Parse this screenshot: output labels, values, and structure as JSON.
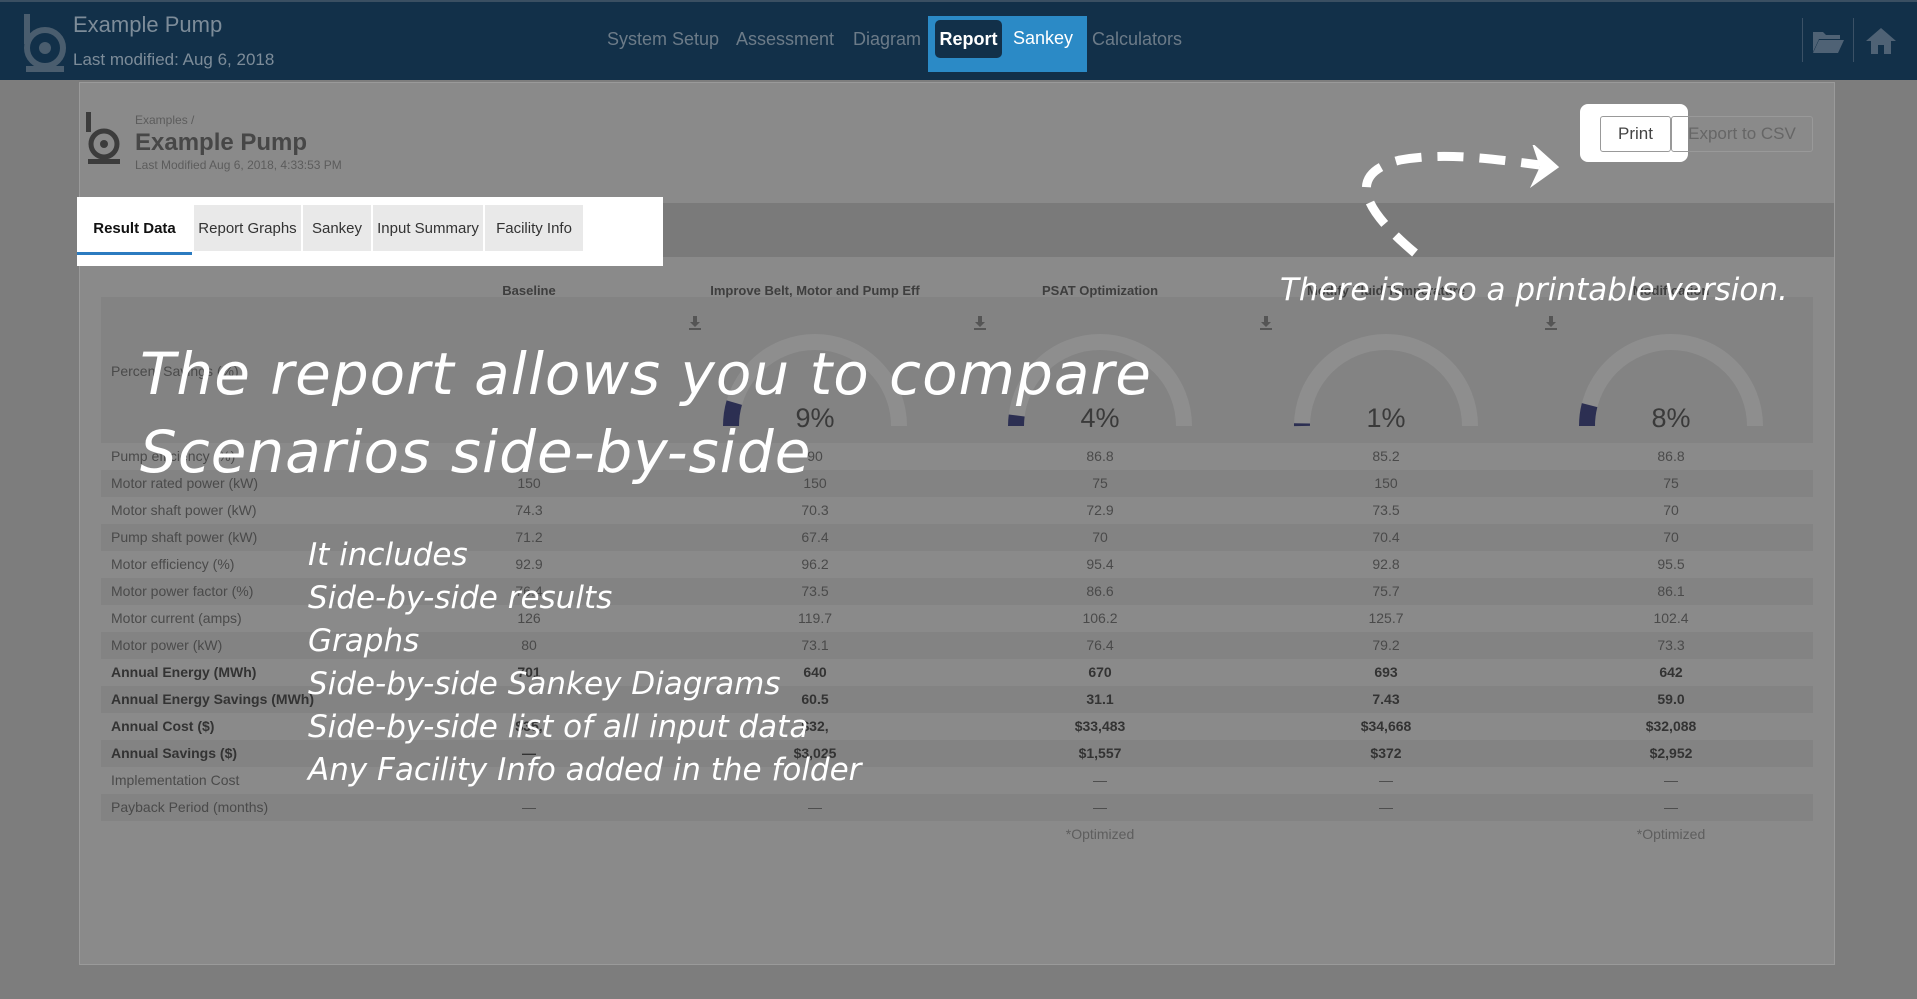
{
  "navbar": {
    "title": "Example Pump",
    "last_modified": "Last modified: Aug 6, 2018",
    "tabs": {
      "system_setup": "System Setup",
      "assessment": "Assessment",
      "diagram": "Diagram",
      "report": "Report",
      "sankey": "Sankey",
      "calculators": "Calculators"
    },
    "icons": [
      "pump-logo-icon",
      "folder-open-icon",
      "home-icon"
    ],
    "active_tab": "Report",
    "accent_color": "#2b8ac6",
    "bg_color": "#123049"
  },
  "report": {
    "breadcrumb": "Examples /",
    "title": "Example Pump",
    "last_modified": "Last Modified Aug 6, 2018, 4:33:53 PM",
    "print_label": "Print",
    "export_label": "Export to CSV",
    "tabs": [
      "Result Data",
      "Report Graphs",
      "Sankey",
      "Input Summary",
      "Facility Info"
    ],
    "active_tab": "Result Data"
  },
  "table": {
    "columns": [
      "Baseline",
      "Improve Belt, Motor and Pump Eff",
      "PSAT Optimization",
      "Modify Fluid Temperature",
      "Modification"
    ],
    "percent_label": "Percent Savings (%)",
    "percent_savings": [
      "",
      "9%",
      "4%",
      "1%",
      "8%"
    ],
    "percent_values": [
      null,
      9,
      4,
      1,
      8
    ],
    "rows": [
      {
        "label": "Pump efficiency (%)",
        "values": [
          "",
          "90",
          "86.8",
          "85.2",
          "86.8"
        ],
        "bold": false
      },
      {
        "label": "Motor rated power (kW)",
        "values": [
          "150",
          "150",
          "75",
          "150",
          "75"
        ],
        "bold": false
      },
      {
        "label": "Motor shaft power (kW)",
        "values": [
          "74.3",
          "70.3",
          "72.9",
          "73.5",
          "70"
        ],
        "bold": false
      },
      {
        "label": "Pump shaft power (kW)",
        "values": [
          "71.2",
          "67.4",
          "70",
          "70.4",
          "70"
        ],
        "bold": false
      },
      {
        "label": "Motor efficiency (%)",
        "values": [
          "92.9",
          "96.2",
          "95.4",
          "92.8",
          "95.5"
        ],
        "bold": false
      },
      {
        "label": "Motor power factor (%)",
        "values": [
          "76.4",
          "73.5",
          "86.6",
          "75.7",
          "86.1"
        ],
        "bold": false
      },
      {
        "label": "Motor current (amps)",
        "values": [
          "126",
          "119.7",
          "106.2",
          "125.7",
          "102.4"
        ],
        "bold": false
      },
      {
        "label": "Motor power (kW)",
        "values": [
          "80",
          "73.1",
          "76.4",
          "79.2",
          "73.3"
        ],
        "bold": false
      },
      {
        "label": "Annual Energy (MWh)",
        "values": [
          "701",
          "640",
          "670",
          "693",
          "642"
        ],
        "bold": true
      },
      {
        "label": "Annual Energy Savings (MWh)",
        "values": [
          "",
          "60.5",
          "31.1",
          "7.43",
          "59.0"
        ],
        "bold": true
      },
      {
        "label": "Annual Cost ($)",
        "values": [
          "$35,",
          "$32,",
          "$33,483",
          "$34,668",
          "$32,088"
        ],
        "bold": true
      },
      {
        "label": "Annual Savings ($)",
        "values": [
          "—",
          "$3,025",
          "$1,557",
          "$372",
          "$2,952"
        ],
        "bold": true
      },
      {
        "label": "Implementation Cost",
        "values": [
          "",
          "",
          "—",
          "—",
          "—"
        ],
        "bold": false
      },
      {
        "label": "Payback Period (months)",
        "values": [
          "—",
          "—",
          "—",
          "—",
          "—"
        ],
        "bold": false
      }
    ],
    "footnotes": [
      "",
      "",
      "*Optimized",
      "",
      "*Optimized"
    ]
  },
  "annotations": {
    "headline_line1": "The report allows you to compare",
    "headline_line2": "Scenarios side-by-side",
    "includes": [
      "It includes",
      "Side-by-side results",
      "Graphs",
      "Side-by-side Sankey Diagrams",
      "Side-by-side list of all input data",
      "Any Facility Info added in the folder"
    ],
    "print_note": "There is also a printable version."
  }
}
